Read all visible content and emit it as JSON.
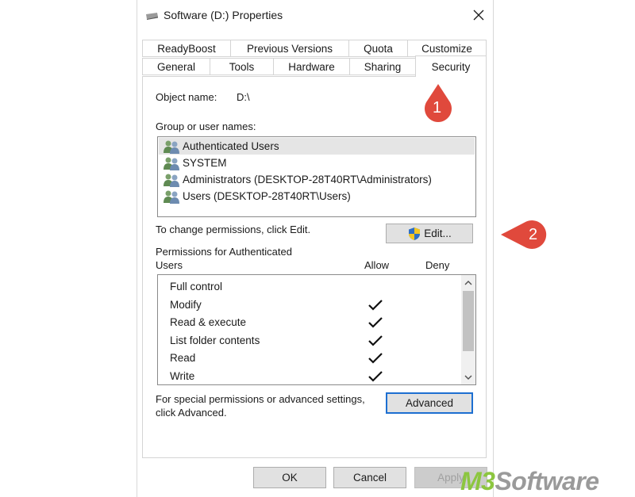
{
  "window": {
    "title": "Software (D:) Properties"
  },
  "tabs_row1": [
    "ReadyBoost",
    "Previous Versions",
    "Quota",
    "Customize"
  ],
  "tabs_row2": [
    "General",
    "Tools",
    "Hardware",
    "Sharing",
    "Security"
  ],
  "active_tab": "Security",
  "security": {
    "object_name_label": "Object name:",
    "object_name_value": "D:\\",
    "group_label": "Group or user names:",
    "users": [
      "Authenticated Users",
      "SYSTEM",
      "Administrators (DESKTOP-28T40RT\\Administrators)",
      "Users (DESKTOP-28T40RT\\Users)"
    ],
    "selected_user_index": 0,
    "change_text": "To change permissions, click Edit.",
    "edit_label": "Edit...",
    "perm_for_line1": "Permissions for Authenticated",
    "perm_for_line2": "Users",
    "allow_label": "Allow",
    "deny_label": "Deny",
    "permissions": [
      {
        "name": "Full control",
        "allow": false,
        "deny": false
      },
      {
        "name": "Modify",
        "allow": true,
        "deny": false
      },
      {
        "name": "Read & execute",
        "allow": true,
        "deny": false
      },
      {
        "name": "List folder contents",
        "allow": true,
        "deny": false
      },
      {
        "name": "Read",
        "allow": true,
        "deny": false
      },
      {
        "name": "Write",
        "allow": true,
        "deny": false
      }
    ],
    "special_line1": "For special permissions or advanced settings,",
    "special_line2": "click Advanced.",
    "advanced_label": "Advanced"
  },
  "footer": {
    "ok_label": "OK",
    "cancel_label": "Cancel",
    "apply_label": "Apply"
  },
  "annotations": {
    "callout1": "1",
    "callout2": "2",
    "callout_color": "#e0493c"
  },
  "watermark": {
    "part1": "M3",
    "part2": " Software",
    "color1": "#8cc63f",
    "color2": "#9a9a9a"
  },
  "icons": {
    "title": "drive-icon",
    "close": "close-icon",
    "user": "user-group-icon",
    "shield": "uac-shield-icon",
    "check": "checkmark-icon",
    "scroll_up": "chevron-up-icon",
    "scroll_down": "chevron-down-icon"
  }
}
